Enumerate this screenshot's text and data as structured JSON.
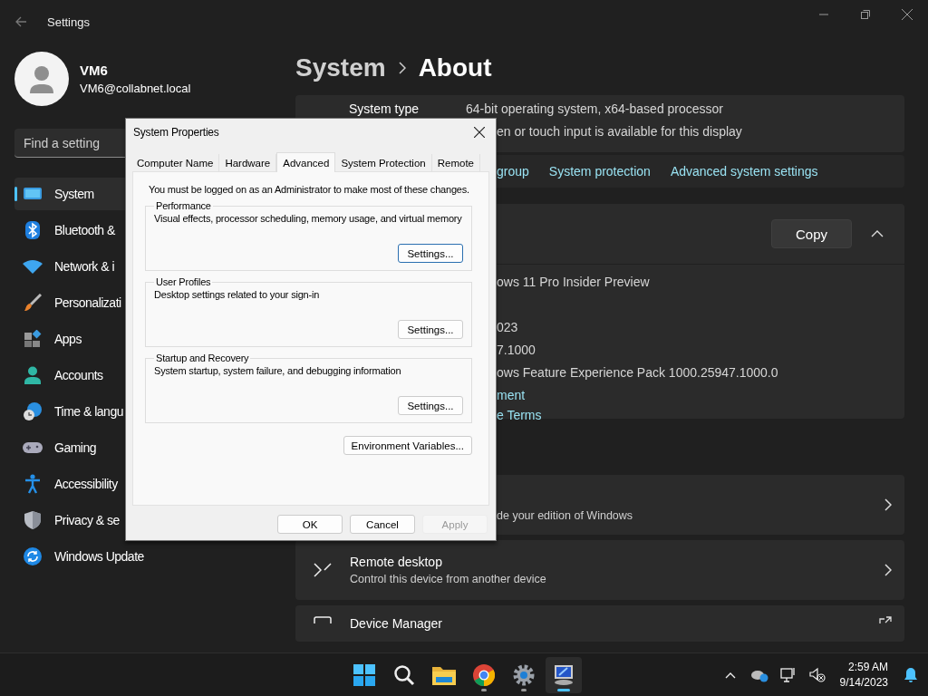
{
  "window": {
    "title": "Settings"
  },
  "profile": {
    "name": "VM6",
    "email": "VM6@collabnet.local"
  },
  "search": {
    "placeholder": "Find a setting"
  },
  "nav": [
    {
      "label": "System",
      "selected": true
    },
    {
      "label": "Bluetooth &",
      "selected": false
    },
    {
      "label": "Network & i",
      "selected": false
    },
    {
      "label": "Personalizati",
      "selected": false
    },
    {
      "label": "Apps",
      "selected": false
    },
    {
      "label": "Accounts",
      "selected": false
    },
    {
      "label": "Time & langu",
      "selected": false
    },
    {
      "label": "Gaming",
      "selected": false
    },
    {
      "label": "Accessibility",
      "selected": false
    },
    {
      "label": "Privacy & se",
      "selected": false
    },
    {
      "label": "Windows Update",
      "selected": false
    }
  ],
  "breadcrumb": [
    "System",
    "About"
  ],
  "device_specs": [
    {
      "label": "System type",
      "value": "64-bit operating system, x64-based processor"
    },
    {
      "value": "en or touch input is available for this display"
    }
  ],
  "related_links": [
    "group",
    "System protection",
    "Advanced system settings"
  ],
  "windows_specs": {
    "copy_button": "Copy",
    "expanded": true,
    "lines": [
      "ows 11 Pro Insider Preview",
      "023",
      "7.1000",
      "ows Feature Experience Pack 1000.25947.1000.0"
    ],
    "links": [
      "ment",
      "e Terms"
    ]
  },
  "cards": [
    {
      "kind": "link",
      "subtitle": "de your edition of Windows"
    },
    {
      "kind": "link",
      "title": "Remote desktop",
      "subtitle": "Control this device from another device"
    },
    {
      "kind": "external",
      "title": "Device Manager"
    }
  ],
  "dialog": {
    "title": "System Properties",
    "tabs": [
      {
        "label": "Computer Name",
        "selected": false
      },
      {
        "label": "Hardware",
        "selected": false
      },
      {
        "label": "Advanced",
        "selected": true
      },
      {
        "label": "System Protection",
        "selected": false
      },
      {
        "label": "Remote",
        "selected": false
      }
    ],
    "notice": "You must be logged on as an Administrator to make most of these changes.",
    "groups": [
      {
        "title": "Performance",
        "description": "Visual effects, processor scheduling, memory usage, and virtual memory",
        "button": {
          "label": "Settings...",
          "focused": true
        }
      },
      {
        "title": "User Profiles",
        "description": "Desktop settings related to your sign-in",
        "button": {
          "label": "Settings...",
          "focused": false
        }
      },
      {
        "title": "Startup and Recovery",
        "description": "System startup, system failure, and debugging information",
        "button": {
          "label": "Settings...",
          "focused": false
        }
      }
    ],
    "env_button": "Environment Variables...",
    "buttons": [
      {
        "label": "OK",
        "disabled": false
      },
      {
        "label": "Cancel",
        "disabled": false
      },
      {
        "label": "Apply",
        "disabled": true
      }
    ]
  },
  "taskbar": {
    "apps": [
      {
        "running": false,
        "active": false
      },
      {
        "running": false,
        "active": false
      },
      {
        "running": false,
        "active": false
      },
      {
        "running": true,
        "active": false
      },
      {
        "running": true,
        "active": false
      },
      {
        "running": true,
        "active": true
      }
    ],
    "time": "2:59 AM",
    "date": "9/14/2023"
  }
}
